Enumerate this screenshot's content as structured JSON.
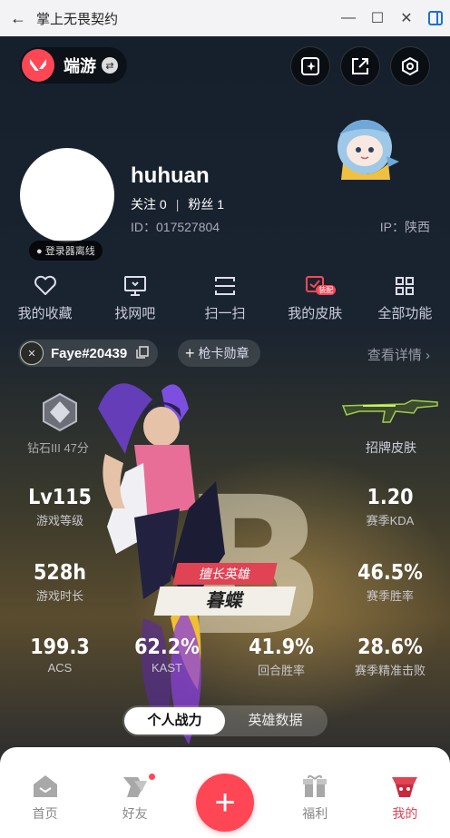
{
  "window": {
    "title": "掌上无畏契约"
  },
  "app": {
    "name": "端游"
  },
  "profile": {
    "username": "huhuan",
    "follow_label": "关注",
    "follow_count": "0",
    "fans_label": "粉丝",
    "fans_count": "1",
    "id_text": "ID：017527804",
    "ip_text": "IP：陕西",
    "status": "● 登录器离线"
  },
  "quick_actions": [
    {
      "label": "我的收藏",
      "icon": "heart-icon"
    },
    {
      "label": "找网吧",
      "icon": "monitor-icon"
    },
    {
      "label": "扫一扫",
      "icon": "scan-icon"
    },
    {
      "label": "我的皮肤",
      "icon": "skin-icon",
      "badge": "装配"
    },
    {
      "label": "全部功能",
      "icon": "grid-icon"
    }
  ],
  "account": {
    "riot_id": "Faye#20439",
    "gun_badge": "枪卡勋章",
    "details_link": "查看详情 ›"
  },
  "rank": {
    "name": "钻石III 47分"
  },
  "skin": {
    "label": "招牌皮肤"
  },
  "stats": {
    "level": {
      "value": "Lv115",
      "label": "游戏等级"
    },
    "kda": {
      "value": "1.20",
      "label": "赛季KDA"
    },
    "hours": {
      "value": "528h",
      "label": "游戏时长"
    },
    "winrate": {
      "value": "46.5%",
      "label": "赛季胜率"
    },
    "acs": {
      "value": "199.3",
      "label": "ACS"
    },
    "kast": {
      "value": "62.2%",
      "label": "KAST"
    },
    "round_win": {
      "value": "41.9%",
      "label": "回合胜率"
    },
    "headshot": {
      "value": "28.6%",
      "label": "赛季精准击败"
    }
  },
  "grade_letter": "B",
  "hero": {
    "tag": "擅长英雄",
    "name": "暮蝶"
  },
  "tabs": [
    {
      "label": "个人战力",
      "active": true
    },
    {
      "label": "英雄数据",
      "active": false
    }
  ],
  "nav": [
    {
      "label": "首页",
      "icon": "home-icon"
    },
    {
      "label": "好友",
      "icon": "friends-icon"
    },
    {
      "label": "+",
      "icon": "plus-icon"
    },
    {
      "label": "福利",
      "icon": "gift-icon"
    },
    {
      "label": "我的",
      "icon": "profile-icon"
    }
  ],
  "colors": {
    "accent": "#ff4655",
    "dark_bg": "#16202c"
  }
}
